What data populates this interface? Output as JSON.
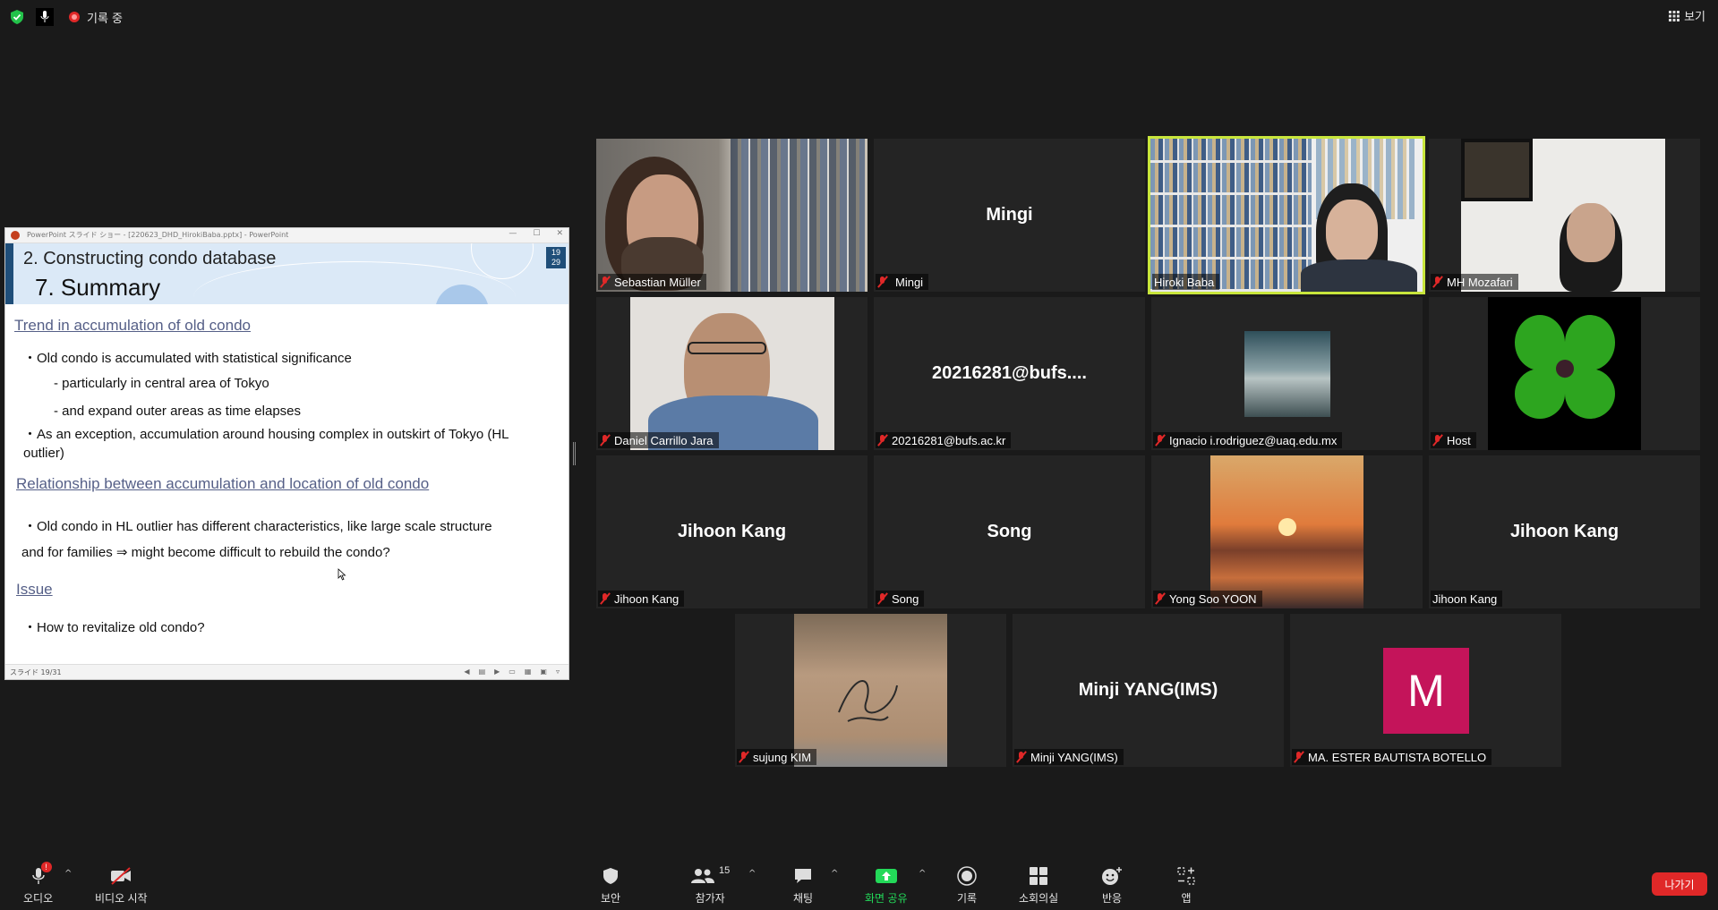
{
  "topbar": {
    "recording_label": "기록 중",
    "view_label": "보기"
  },
  "ppt": {
    "window_title": "PowerPoint スライド ショー - [220623_DHD_HirokiBaba.pptx] - PowerPoint",
    "status_text": "スライド 19/31",
    "slide": {
      "section_title": "2. Constructing condo database",
      "number_prefix": "7.",
      "title": "Summary",
      "slide_num_top": "19",
      "slide_num_bottom": "29",
      "heading1": "Trend in accumulation of old condo",
      "bullet1": "・Old condo is accumulated with statistical significance",
      "sub1": "- particularly in central area of Tokyo",
      "sub2": "- and expand outer areas as time elapses",
      "bullet2": "・As an exception, accumulation around housing complex in outskirt of Tokyo (HL outlier)",
      "heading2": "Relationship between accumulation and location of old condo",
      "bullet3_line1": "・Old condo in HL outlier has different characteristics, like large scale structure",
      "bullet3_line2": "and for families ⇒ might become difficult to rebuild the condo?",
      "heading3": "Issue",
      "bullet4": "・How to revitalize old condo?"
    }
  },
  "participants": [
    {
      "label": "Sebastian Müller",
      "display": "",
      "video": "bookshelf-man"
    },
    {
      "label": "Mingi",
      "display": "Mingi",
      "video": ""
    },
    {
      "label": "Hiroki Baba",
      "display": "",
      "video": "bookshelf-speaker"
    },
    {
      "label": "MH Mozafari",
      "display": "",
      "video": "office-man"
    },
    {
      "label": "Daniel Carrillo Jara",
      "display": "",
      "video": "man-glasses"
    },
    {
      "label": "20216281@bufs.ac.kr",
      "display": "20216281@bufs....",
      "video": ""
    },
    {
      "label": "Ignacio i.rodriguez@uaq.edu.mx",
      "display": "",
      "video": "sea-photo"
    },
    {
      "label": "Host",
      "display": "",
      "video": "clover-photo"
    },
    {
      "label": "Jihoon Kang",
      "display": "Jihoon Kang",
      "video": ""
    },
    {
      "label": "Song",
      "display": "Song",
      "video": ""
    },
    {
      "label": "Yong Soo YOON",
      "display": "",
      "video": "sunset-photo"
    },
    {
      "label": "Jihoon Kang",
      "display": "Jihoon Kang",
      "video": ""
    },
    {
      "label": "sujung KIM",
      "display": "",
      "video": "card-photo"
    },
    {
      "label": "Minji YANG(IMS)",
      "display": "Minji YANG(IMS)",
      "video": ""
    },
    {
      "label": "MA. ESTER BAUTISTA BOTELLO",
      "display": "M",
      "video": "avatar"
    }
  ],
  "avatar_color": "#c4145a",
  "toolbar": {
    "audio": "오디오",
    "video": "비디오 시작",
    "security": "보안",
    "participants": "참가자",
    "participants_count": "15",
    "chat": "채팅",
    "share": "화면 공유",
    "record": "기록",
    "breakout": "소회의실",
    "reactions": "반응",
    "apps": "앱",
    "leave": "나가기",
    "audio_badge": "!"
  },
  "colors": {
    "share_green": "#23d959",
    "leave_red": "#e02828",
    "active_speaker": "#c8e63c"
  }
}
